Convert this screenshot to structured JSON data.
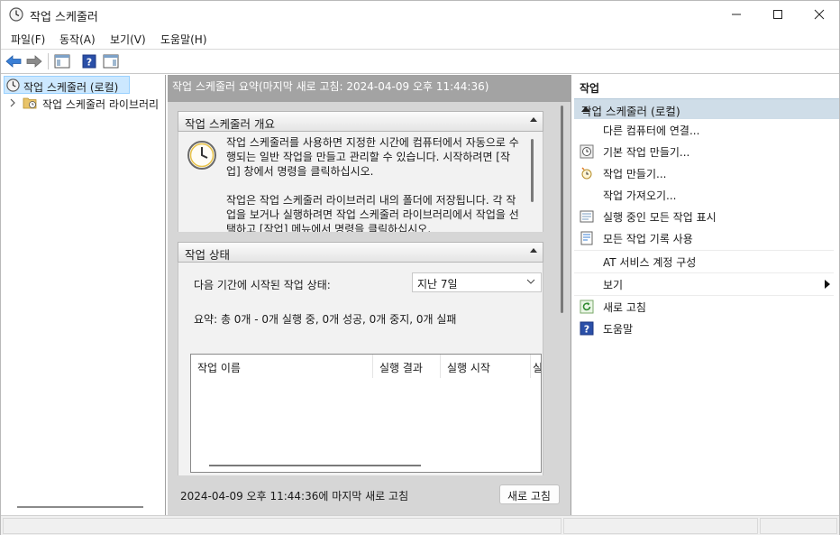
{
  "window": {
    "title": "작업 스케줄러",
    "icon": "clock-icon"
  },
  "menu": [
    {
      "label": "파일(F)"
    },
    {
      "label": "동작(A)"
    },
    {
      "label": "보기(V)"
    },
    {
      "label": "도움말(H)"
    }
  ],
  "toolbar": {
    "icons": [
      "back-arrow-icon",
      "forward-arrow-icon",
      "show-hide-console-tree-icon",
      "help-icon",
      "show-hide-action-pane-icon"
    ]
  },
  "tree": {
    "root": "작업 스케줄러 (로컬)",
    "child": "작업 스케줄러 라이브러리"
  },
  "center": {
    "header": "작업 스케줄러 요약(마지막 새로 고침: 2024-04-09 오후 11:44:36)",
    "overview": {
      "title": "작업 스케줄러 개요",
      "paragraph1": "작업 스케줄러를 사용하면 지정한 시간에 컴퓨터에서 자동으로 수행되는 일반 작업을 만들고 관리할 수 있습니다. 시작하려면 [작업] 창에서 명령을 클릭하십시오.",
      "paragraph2": "작업은 작업 스케줄러 라이브러리 내의 폴더에 저장됩니다. 각 작업을 보거나 실행하려면 작업 스케줄러 라이브러리에서 작업을 선택하고 [작업] 메뉴에서 명령을 클릭하십시오."
    },
    "status": {
      "title": "작업 상태",
      "period_label": "다음 기간에 시작된 작업 상태:",
      "period_value": "지난 7일",
      "summary": "요약: 총 0개 - 0개 실행 중, 0개 성공, 0개 중지, 0개 실패",
      "columns": [
        "작업 이름",
        "실행 결과",
        "실행 시작",
        "실"
      ]
    },
    "footer": {
      "last_refresh": "2024-04-09 오후 11:44:36에 마지막 새로 고침",
      "refresh_button": "새로 고침"
    }
  },
  "actions": {
    "pane_title": "작업",
    "group_title": "작업 스케줄러 (로컬)",
    "items": [
      {
        "label": "다른 컴퓨터에 연결...",
        "icon": ""
      },
      {
        "label": "기본 작업 만들기...",
        "icon": "basic-task-icon"
      },
      {
        "label": "작업 만들기...",
        "icon": "create-task-icon"
      },
      {
        "label": "작업 가져오기...",
        "icon": ""
      },
      {
        "label": "실행 중인 모든 작업 표시",
        "icon": "running-tasks-icon"
      },
      {
        "label": "모든 작업 기록 사용",
        "icon": "task-history-icon"
      },
      {
        "label": "AT 서비스 계정 구성",
        "icon": ""
      },
      {
        "label": "보기",
        "icon": ""
      },
      {
        "label": "새로 고침",
        "icon": "refresh-icon"
      },
      {
        "label": "도움말",
        "icon": "help-icon"
      }
    ]
  }
}
